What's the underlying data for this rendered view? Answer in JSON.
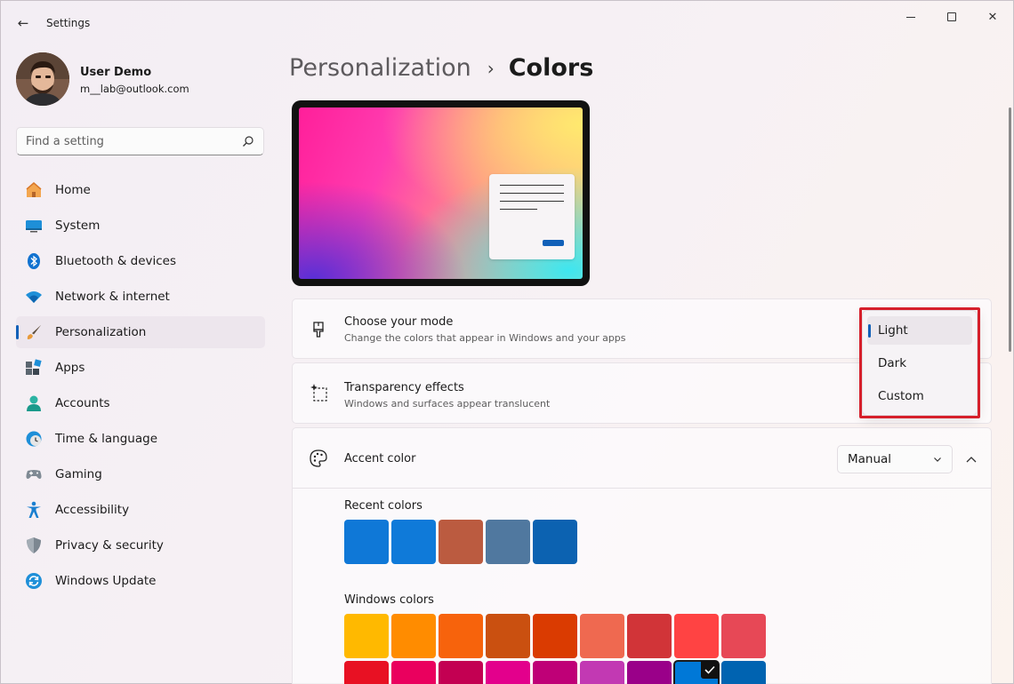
{
  "window": {
    "title": "Settings",
    "back_glyph": "←",
    "close_glyph": "✕"
  },
  "profile": {
    "name": "User Demo",
    "email": "m__lab@outlook.com"
  },
  "search": {
    "placeholder": "Find a setting"
  },
  "sidebar": {
    "items": [
      {
        "label": "Home",
        "icon": "home-icon"
      },
      {
        "label": "System",
        "icon": "system-icon"
      },
      {
        "label": "Bluetooth & devices",
        "icon": "bluetooth-icon"
      },
      {
        "label": "Network & internet",
        "icon": "wifi-icon"
      },
      {
        "label": "Personalization",
        "icon": "brush-icon",
        "active": true
      },
      {
        "label": "Apps",
        "icon": "apps-icon"
      },
      {
        "label": "Accounts",
        "icon": "person-icon"
      },
      {
        "label": "Time & language",
        "icon": "clock-globe-icon"
      },
      {
        "label": "Gaming",
        "icon": "gamepad-icon"
      },
      {
        "label": "Accessibility",
        "icon": "accessibility-icon"
      },
      {
        "label": "Privacy & security",
        "icon": "shield-icon"
      },
      {
        "label": "Windows Update",
        "icon": "update-icon"
      }
    ]
  },
  "breadcrumb": {
    "parent": "Personalization",
    "separator": "›",
    "current": "Colors"
  },
  "mode": {
    "title": "Choose your mode",
    "subtitle": "Change the colors that appear in Windows and your apps",
    "options": [
      "Light",
      "Dark",
      "Custom"
    ],
    "selected": "Light"
  },
  "transparency": {
    "title": "Transparency effects",
    "subtitle": "Windows and surfaces appear translucent"
  },
  "accent": {
    "title": "Accent color",
    "select_value": "Manual",
    "recent_label": "Recent colors",
    "recent_colors": [
      "#0f78d7",
      "#0f7ad9",
      "#bb5b40",
      "#50789f",
      "#0c62b1"
    ],
    "windows_label": "Windows colors",
    "windows_colors_row1": [
      "#ffb900",
      "#ff8c00",
      "#f7630c",
      "#ca5010",
      "#da3b01",
      "#ef6950",
      "#d13438",
      "#ff4343",
      "#e74856"
    ],
    "windows_colors_row2": [
      "#e81123",
      "#ea005e",
      "#c30052",
      "#e3008c",
      "#bf0077",
      "#c239b3",
      "#9a0089",
      "#0078d7",
      "#0063b1"
    ],
    "selected_windows_color_index": 7
  },
  "colors": {
    "accent": "#1160b8",
    "highlight": "#d61f2b"
  }
}
